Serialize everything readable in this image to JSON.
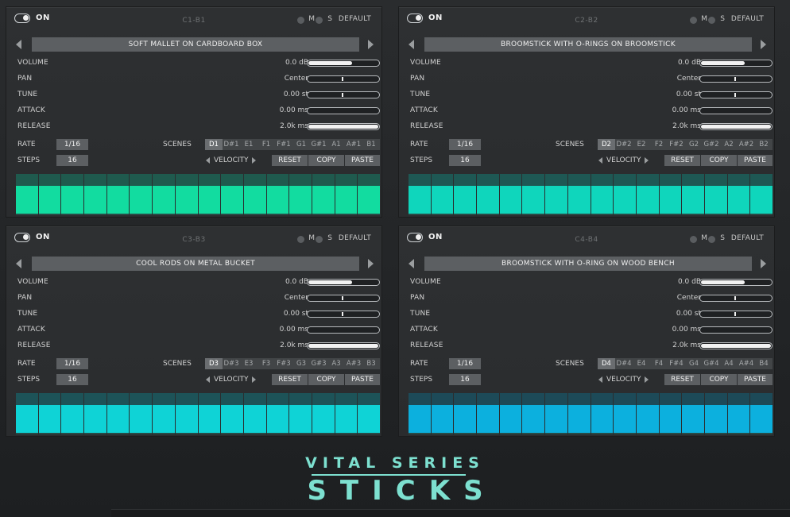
{
  "panels": [
    {
      "on_label": "ON",
      "range": "C1-B1",
      "m": "M",
      "s": "S",
      "default": "DEFAULT",
      "preset": "SOFT MALLET ON CARDBOARD BOX",
      "params": [
        {
          "label": "VOLUME",
          "value": "0.0 dB",
          "level": 0.62,
          "kind": "fill"
        },
        {
          "label": "PAN",
          "value": "Center",
          "level": 0.5,
          "kind": "tick"
        },
        {
          "label": "TUNE",
          "value": "0.00 st",
          "level": 0.5,
          "kind": "tick"
        },
        {
          "label": "ATTACK",
          "value": "0.00 ms",
          "level": 0.0,
          "kind": "fill"
        },
        {
          "label": "RELEASE",
          "value": "2.0k ms",
          "level": 1.0,
          "kind": "fill"
        }
      ],
      "rate_label": "RATE",
      "rate": "1/16",
      "steps_label": "STEPS",
      "steps": "16",
      "scenes_label": "SCENES",
      "scenes": [
        "D1",
        "D#1",
        "E1",
        "F1",
        "F#1",
        "G1",
        "G#1",
        "A1",
        "A#1",
        "B1"
      ],
      "active_scene": 0,
      "velocity": "VELOCITY",
      "reset": "RESET",
      "copy": "COPY",
      "paste": "PASTE",
      "step_color": "#12dca0",
      "step_top": "#1f5a4e"
    },
    {
      "on_label": "ON",
      "range": "C2-B2",
      "m": "M",
      "s": "S",
      "default": "DEFAULT",
      "preset": "BROOMSTICK WITH O-RINGS ON BROOMSTICK",
      "params": [
        {
          "label": "VOLUME",
          "value": "0.0 dB",
          "level": 0.62,
          "kind": "fill"
        },
        {
          "label": "PAN",
          "value": "Center",
          "level": 0.5,
          "kind": "tick"
        },
        {
          "label": "TUNE",
          "value": "0.00 st",
          "level": 0.5,
          "kind": "tick"
        },
        {
          "label": "ATTACK",
          "value": "0.00 ms",
          "level": 0.0,
          "kind": "fill"
        },
        {
          "label": "RELEASE",
          "value": "2.0k ms",
          "level": 1.0,
          "kind": "fill"
        }
      ],
      "rate_label": "RATE",
      "rate": "1/16",
      "steps_label": "STEPS",
      "steps": "16",
      "scenes_label": "SCENES",
      "scenes": [
        "D2",
        "D#2",
        "E2",
        "F2",
        "F#2",
        "G2",
        "G#2",
        "A2",
        "A#2",
        "B2"
      ],
      "active_scene": 0,
      "velocity": "VELOCITY",
      "reset": "RESET",
      "copy": "COPY",
      "paste": "PASTE",
      "step_color": "#0fd6bc",
      "step_top": "#1e5854"
    },
    {
      "on_label": "ON",
      "range": "C3-B3",
      "m": "M",
      "s": "S",
      "default": "DEFAULT",
      "preset": "COOL RODS ON METAL BUCKET",
      "params": [
        {
          "label": "VOLUME",
          "value": "0.0 dB",
          "level": 0.62,
          "kind": "fill"
        },
        {
          "label": "PAN",
          "value": "Center",
          "level": 0.5,
          "kind": "tick"
        },
        {
          "label": "TUNE",
          "value": "0.00 st",
          "level": 0.5,
          "kind": "tick"
        },
        {
          "label": "ATTACK",
          "value": "0.00 ms",
          "level": 0.0,
          "kind": "fill"
        },
        {
          "label": "RELEASE",
          "value": "2.0k ms",
          "level": 1.0,
          "kind": "fill"
        }
      ],
      "rate_label": "RATE",
      "rate": "1/16",
      "steps_label": "STEPS",
      "steps": "16",
      "scenes_label": "SCENES",
      "scenes": [
        "D3",
        "D#3",
        "E3",
        "F3",
        "F#3",
        "G3",
        "G#3",
        "A3",
        "A#3",
        "B3"
      ],
      "active_scene": 0,
      "velocity": "VELOCITY",
      "reset": "RESET",
      "copy": "COPY",
      "paste": "PASTE",
      "step_color": "#0fd3d6",
      "step_top": "#1d5358"
    },
    {
      "on_label": "ON",
      "range": "C4-B4",
      "m": "M",
      "s": "S",
      "default": "DEFAULT",
      "preset": "BROOMSTICK WITH O-RING ON WOOD BENCH",
      "params": [
        {
          "label": "VOLUME",
          "value": "0.0 dB",
          "level": 0.62,
          "kind": "fill"
        },
        {
          "label": "PAN",
          "value": "Center",
          "level": 0.5,
          "kind": "tick"
        },
        {
          "label": "TUNE",
          "value": "0.00 st",
          "level": 0.5,
          "kind": "tick"
        },
        {
          "label": "ATTACK",
          "value": "0.00 ms",
          "level": 0.0,
          "kind": "fill"
        },
        {
          "label": "RELEASE",
          "value": "2.0k ms",
          "level": 1.0,
          "kind": "fill"
        }
      ],
      "rate_label": "RATE",
      "rate": "1/16",
      "steps_label": "STEPS",
      "steps": "16",
      "scenes_label": "SCENES",
      "scenes": [
        "D4",
        "D#4",
        "E4",
        "F4",
        "F#4",
        "G4",
        "G#4",
        "A4",
        "A#4",
        "B4"
      ],
      "active_scene": 0,
      "velocity": "VELOCITY",
      "reset": "RESET",
      "copy": "COPY",
      "paste": "PASTE",
      "step_color": "#0cb0de",
      "step_top": "#1d4a58"
    }
  ],
  "logo": {
    "line1": "VITAL SERIES",
    "line2": "STICKS",
    "color": "#7de0d0"
  }
}
